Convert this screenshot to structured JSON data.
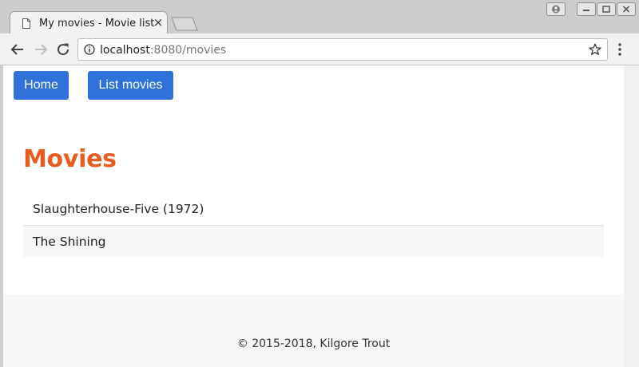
{
  "browser": {
    "tab": {
      "title": "My movies - Movie list",
      "close_glyph": "×"
    },
    "address": {
      "host": "localhost",
      "rest": ":8080/movies"
    }
  },
  "page": {
    "nav": {
      "home_label": "Home",
      "list_label": "List movies"
    },
    "title": "Movies",
    "movies": [
      "Slaughterhouse-Five (1972)",
      "The Shining"
    ],
    "footer": "© 2015-2018, Kilgore Trout"
  },
  "colors": {
    "button": "#2f72d9",
    "title": "#e95b1e",
    "stripe": "#f7f7f7"
  },
  "icons": [
    "page-icon",
    "close-icon",
    "back-icon",
    "forward-icon",
    "reload-icon",
    "info-icon",
    "star-icon",
    "menu-icon"
  ]
}
